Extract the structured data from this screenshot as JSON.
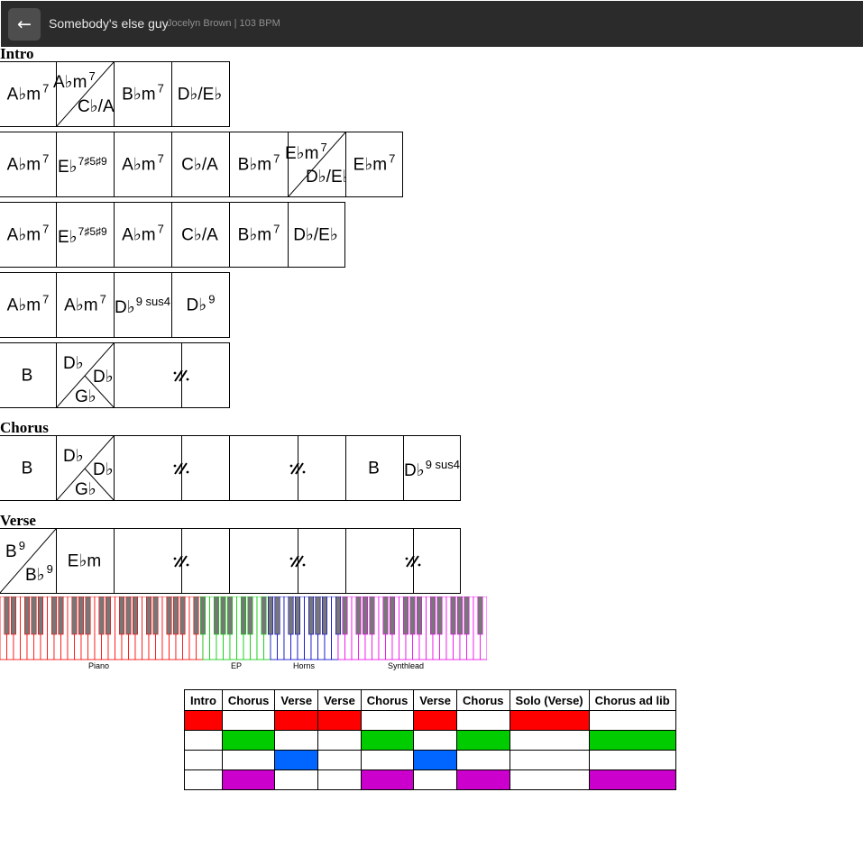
{
  "header": {
    "back_label": "←",
    "title": "Somebody's else guy",
    "meta": "Jocelyn Brown | 103 BPM"
  },
  "sections": {
    "intro": "Intro",
    "chorus": "Chorus",
    "verse": "Verse"
  },
  "chords": {
    "r1": [
      {
        "root": "A♭m",
        "ext": "7"
      },
      {
        "top": "A♭m",
        "top_ext": "7",
        "bottom": "C♭/A"
      },
      {
        "root": "B♭m",
        "ext": "7"
      },
      {
        "root": "D♭/E♭",
        "ext": ""
      }
    ],
    "r2": [
      {
        "root": "A♭m",
        "ext": "7"
      },
      {
        "root": "E♭",
        "ext": "7♯5♯9"
      },
      {
        "root": "A♭m",
        "ext": "7"
      },
      {
        "root": "C♭/A",
        "ext": ""
      },
      {
        "root": "B♭m",
        "ext": "7"
      },
      {
        "top": "E♭m",
        "top_ext": "7",
        "bottom": "D♭/E♭"
      },
      {
        "root": "E♭m",
        "ext": "7"
      }
    ],
    "r3": [
      {
        "root": "A♭m",
        "ext": "7"
      },
      {
        "root": "E♭",
        "ext": "7♯5♯9"
      },
      {
        "root": "A♭m",
        "ext": "7"
      },
      {
        "root": "C♭/A",
        "ext": ""
      },
      {
        "root": "B♭m",
        "ext": "7"
      },
      {
        "root": "D♭/E♭",
        "ext": ""
      }
    ],
    "r4": [
      {
        "root": "A♭m",
        "ext": "7"
      },
      {
        "root": "A♭m",
        "ext": "7"
      },
      {
        "root": "D♭",
        "ext": "9 sus4"
      },
      {
        "root": "D♭",
        "ext": "9"
      }
    ],
    "r5": [
      {
        "root": "B",
        "ext": ""
      },
      {
        "a": "D♭",
        "b": "D♭",
        "c": "G♭"
      }
    ],
    "chorus": [
      {
        "root": "B",
        "ext": ""
      },
      {
        "a": "D♭",
        "b": "D♭",
        "c": "G♭"
      },
      {
        "root": "B",
        "ext": ""
      },
      {
        "root": "D♭",
        "ext": "9 sus4"
      }
    ],
    "verse": [
      {
        "top": "B",
        "top_ext": "9",
        "bottom": "B♭",
        "bottom_ext": "9"
      },
      {
        "root": "E♭m",
        "ext": ""
      }
    ]
  },
  "instruments": {
    "piano": {
      "name": "Piano",
      "color": "#ff0000"
    },
    "ep": {
      "name": "EP",
      "color": "#00cc00"
    },
    "horns": {
      "name": "Horns",
      "color": "#0000cc"
    },
    "synth": {
      "name": "Synthlead",
      "color": "#ee00ee"
    }
  },
  "arrangement": {
    "headers": [
      "Intro",
      "Chorus",
      "Verse",
      "Verse",
      "Chorus",
      "Verse",
      "Chorus",
      "Solo (Verse)",
      "Chorus ad lib"
    ],
    "rows": [
      {
        "instrument": "Piano",
        "color": "#ff0000",
        "active": [
          1,
          0,
          1,
          1,
          0,
          1,
          0,
          1,
          0
        ]
      },
      {
        "instrument": "EP",
        "color": "#00cc00",
        "active": [
          0,
          1,
          0,
          0,
          1,
          0,
          1,
          0,
          1
        ]
      },
      {
        "instrument": "Horns",
        "color": "#0066ff",
        "active": [
          0,
          0,
          1,
          0,
          0,
          1,
          0,
          0,
          0
        ]
      },
      {
        "instrument": "Synthlead",
        "color": "#cc00cc",
        "active": [
          0,
          1,
          0,
          0,
          1,
          0,
          1,
          0,
          1
        ]
      }
    ]
  }
}
